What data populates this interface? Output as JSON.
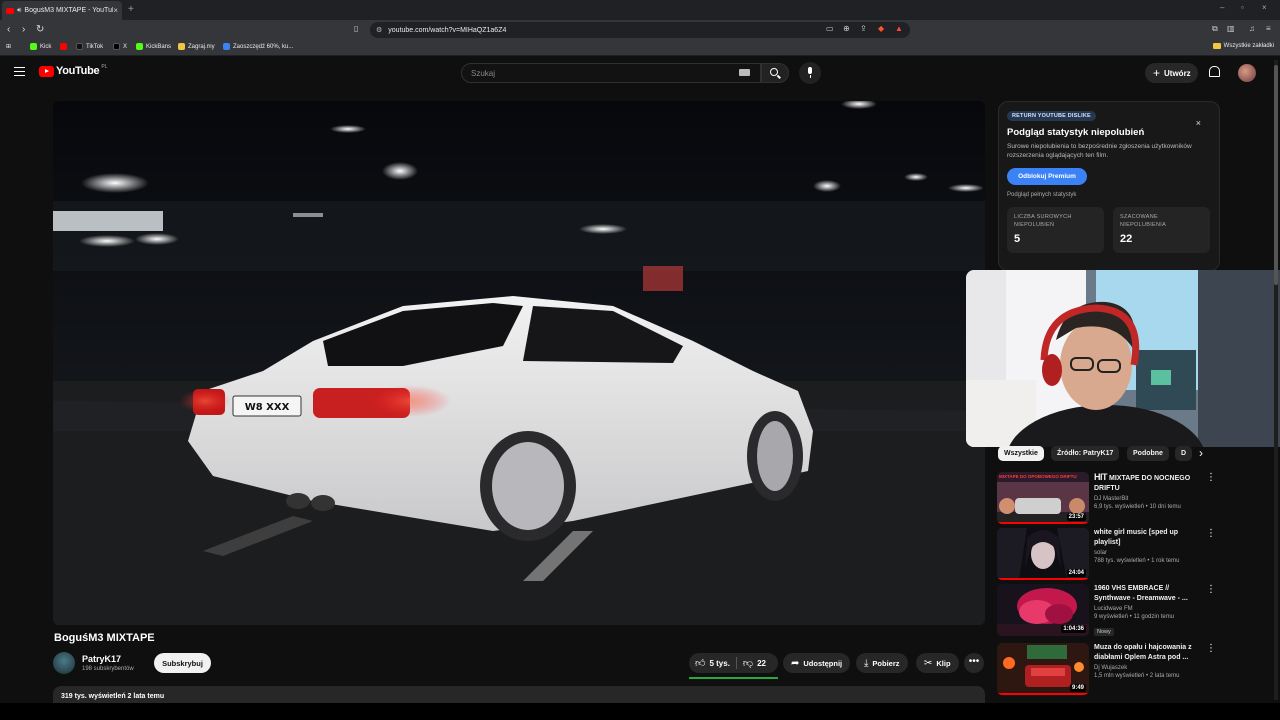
{
  "browser": {
    "tab_title": "BoguśM3 MIXTAPE - YouTube",
    "url": "youtube.com/watch?v=MIHaQZ1a6Z4",
    "bookmarks": [
      {
        "label": "Kick",
        "color": "#53fc18"
      },
      {
        "label": "",
        "color": "#ff0000"
      },
      {
        "label": "TikTok",
        "color": "#111111"
      },
      {
        "label": "X",
        "color": "#000000"
      },
      {
        "label": "KickBans",
        "color": "#53fc18"
      },
      {
        "label": "Zagraj.my",
        "color": "#f4c542"
      },
      {
        "label": "Zaoszczędź 60%, ku...",
        "color": "#3b82f6"
      }
    ],
    "bookmarks_folder": "Wszystkie zakładki"
  },
  "masthead": {
    "logo_text": "YouTube",
    "region": "PL",
    "search_placeholder": "Szukaj",
    "create_label": "Utwórz"
  },
  "video": {
    "title": "BoguśM3 MIXTAPE",
    "plate": "W8 XXX",
    "channel_name": "PatryK17",
    "subscribers": "198 subskrybentów",
    "subscribe_label": "Subskrybuj",
    "likes": "5 tys.",
    "dislikes": "22",
    "like_ratio": 1.0,
    "share_label": "Udostępnij",
    "download_label": "Pobierz",
    "clip_label": "Klip",
    "more_label": "•••",
    "description_meta": "319 tys. wyświetleń  2 lata temu"
  },
  "ryd": {
    "badge": "RETURN YOUTUBE DISLIKE",
    "title": "Podgląd statystyk niepolubień",
    "text": "Surowe niepolubienia to bezpośrednie zgłoszenia użytkowników rozszerzenia oglądających ten film.",
    "button": "Odblokuj Premium",
    "link": "Podgląd pełnych statystyk",
    "close": "×",
    "cards": [
      {
        "label": "LICZBA SUROWYCH NIEPOLUBIEŃ",
        "value": "5"
      },
      {
        "label": "SZACOWANE NIEPOLUBIENIA",
        "value": "22"
      }
    ]
  },
  "chips": [
    "Wszystkie",
    "Źródło: PatryK17",
    "Podobne",
    "D"
  ],
  "chip_next": "›",
  "recommended": [
    {
      "title": "MIXTAPE DO NOCNEGO DRIFTU",
      "title_logo": "HIT",
      "channel": "DJ MasterBit",
      "meta": "6,9 tys. wyświetleń • 10 dni temu",
      "duration": "23:57",
      "thumb_text": "MIXTAPE DO OPOBOWEGO DRIFTU",
      "progress": 1.0,
      "badge": ""
    },
    {
      "title": "white girl music [sped up playlist]",
      "title_logo": "",
      "channel": "solar",
      "meta": "788 tys. wyświetleń • 1 rok temu",
      "duration": "24:04",
      "thumb_text": "",
      "progress": 1.0,
      "badge": ""
    },
    {
      "title": "1960    VHS EMBRACE // Synthwave - Dreamwave - ...",
      "title_logo": "",
      "channel": "Lucidwave FM",
      "meta": "9 wyświetleń • 11 godzin temu",
      "duration": "1:04:36",
      "thumb_text": "",
      "progress": 0,
      "badge": "Nowy"
    },
    {
      "title": "Muza do opału i hajcowania z diabłami Oplem Astra pod ...",
      "title_logo": "",
      "channel": "Dj Wujaszek",
      "meta": "1,5 mln wyświetleń • 2 lata temu",
      "duration": "9:49",
      "thumb_text": "",
      "progress": 1.0,
      "badge": ""
    }
  ]
}
